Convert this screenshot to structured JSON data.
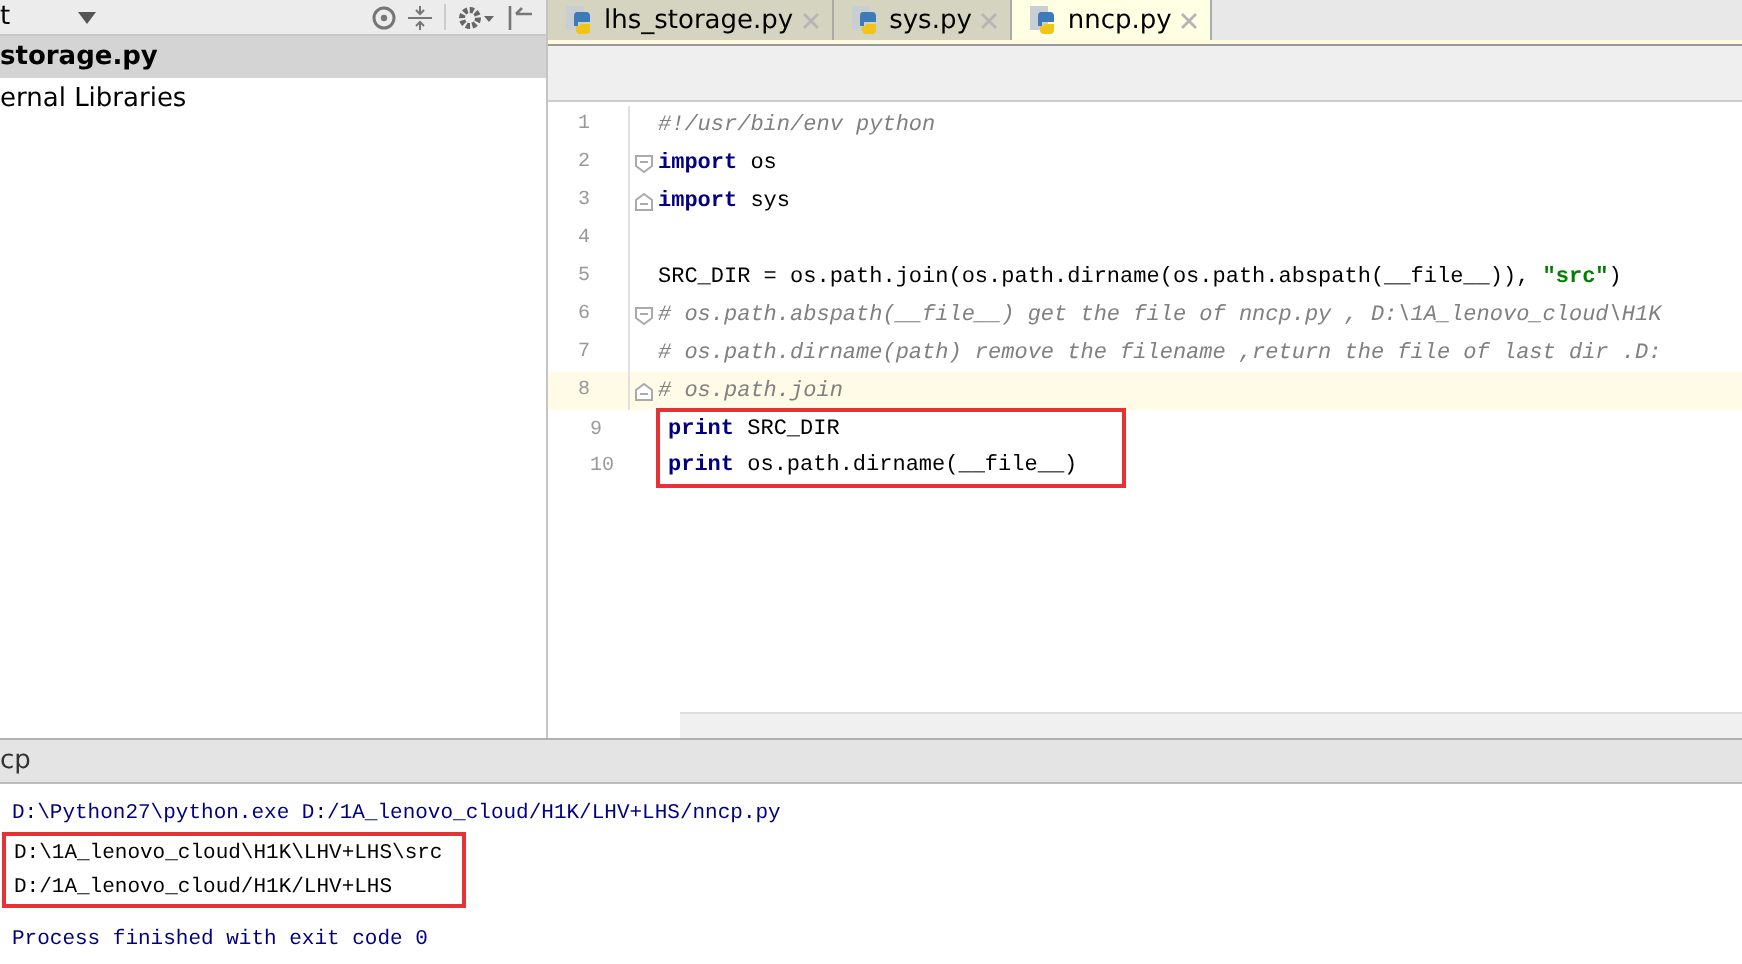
{
  "project_panel": {
    "title": "t",
    "items": [
      {
        "label": "storage.py",
        "selected": true
      },
      {
        "label": "ernal Libraries",
        "selected": false
      }
    ]
  },
  "tabs": [
    {
      "label": "lhs_storage.py",
      "selected": false
    },
    {
      "label": "sys.py",
      "selected": false
    },
    {
      "label": "nncp.py",
      "selected": true
    }
  ],
  "editor": {
    "lines": [
      {
        "number": "1",
        "kind": "plain",
        "current": false,
        "boxed": false,
        "segments": [
          {
            "kind": "comment",
            "text": "#!/usr/bin/env python"
          }
        ]
      },
      {
        "number": "2",
        "kind": "foldstart",
        "current": false,
        "boxed": false,
        "segments": [
          {
            "kind": "keyword",
            "text": "import"
          },
          {
            "kind": "plain",
            "text": " os"
          }
        ]
      },
      {
        "number": "3",
        "kind": "foldend",
        "current": false,
        "boxed": false,
        "segments": [
          {
            "kind": "keyword",
            "text": "import"
          },
          {
            "kind": "plain",
            "text": " sys"
          }
        ]
      },
      {
        "number": "4",
        "kind": "plain",
        "current": false,
        "boxed": false
      },
      {
        "number": "5",
        "kind": "plain",
        "current": false,
        "boxed": false,
        "segments": [
          {
            "kind": "plain",
            "text": "SRC_DIR = os.path.join(os.path.dirname(os.path.abspath(__file__)), "
          },
          {
            "kind": "string",
            "text": "\"src\""
          },
          {
            "kind": "plain",
            "text": ")"
          }
        ]
      },
      {
        "number": "6",
        "kind": "foldstart",
        "current": false,
        "boxed": false,
        "segments": [
          {
            "kind": "comment",
            "text": "# os.path.abspath(__file__) get the file of nncp.py , D:\\1A_lenovo_cloud\\H1K"
          }
        ]
      },
      {
        "number": "7",
        "kind": "plain",
        "current": false,
        "boxed": false,
        "segments": [
          {
            "kind": "comment",
            "text": "# os.path.dirname(path) remove the filename ,return the file of last dir .D:"
          }
        ]
      },
      {
        "number": "8",
        "kind": "foldend",
        "current": true,
        "boxed": false,
        "segments": [
          {
            "kind": "comment",
            "text": "# os.path.join"
          }
        ]
      },
      {
        "number": "9",
        "kind": "plain",
        "current": false,
        "boxed": true,
        "segments": [
          {
            "kind": "keyword",
            "text": "print"
          },
          {
            "kind": "plain",
            "text": " SRC_DIR"
          }
        ]
      },
      {
        "number": "10",
        "kind": "plain",
        "current": false,
        "boxed": true,
        "segments": [
          {
            "kind": "keyword",
            "text": "print"
          },
          {
            "kind": "plain",
            "text": " os.path.dirname(__file__)"
          }
        ]
      }
    ]
  },
  "run_panel": {
    "title": "cp",
    "lines": [
      {
        "kind": "command",
        "boxed": false,
        "text": "D:\\Python27\\python.exe D:/1A_lenovo_cloud/H1K/LHV+LHS/nncp.py"
      },
      {
        "kind": "output",
        "boxed": true,
        "text": "D:\\1A_lenovo_cloud\\H1K\\LHV+LHS\\src"
      },
      {
        "kind": "output",
        "boxed": true,
        "text": "D:/1A_lenovo_cloud/H1K/LHV+LHS"
      },
      {
        "kind": "status",
        "boxed": false,
        "text": "Process finished with exit code 0"
      }
    ]
  }
}
